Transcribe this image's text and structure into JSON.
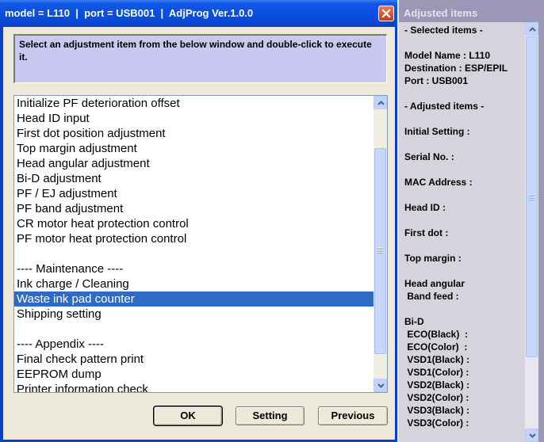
{
  "window": {
    "title": "model = L110  |  port = USB001  |  AdjProg Ver.1.0.0"
  },
  "instructions": "Select an adjustment item from the below window and double-click to execute it.",
  "list_items": [
    "Initialize PF deterioration offset",
    "Head ID input",
    "First dot position adjustment",
    "Top margin adjustment",
    "Head angular adjustment",
    "Bi-D adjustment",
    "PF / EJ adjustment",
    "PF band adjustment",
    "CR motor heat protection control",
    "PF motor heat protection control",
    "",
    "---- Maintenance ----",
    "Ink charge / Cleaning",
    "Waste ink pad counter",
    "Shipping setting",
    "",
    "---- Appendix ----",
    "Final check pattern print",
    "EEPROM dump",
    "Printer information check"
  ],
  "selected_index": 13,
  "buttons": {
    "ok": "OK",
    "setting": "Setting",
    "previous": "Previous"
  },
  "side_panel": {
    "title": "Adjusted items",
    "lines": [
      "- Selected items -",
      "",
      "Model Name : L110",
      "Destination : ESP/EPIL",
      "Port : USB001",
      "",
      "- Adjusted items -",
      "",
      "Initial Setting :",
      "",
      "Serial No. :",
      "",
      "MAC Address :",
      "",
      "Head ID :",
      "",
      "First dot :",
      "",
      "Top margin :",
      "",
      "Head angular",
      " Band feed :",
      "",
      "Bi-D",
      " ECO(Black)  :",
      " ECO(Color)  :",
      " VSD1(Black) :",
      " VSD1(Color) :",
      " VSD2(Black) :",
      " VSD2(Color) :",
      " VSD3(Black) :",
      " VSD3(Color) :"
    ]
  },
  "icons": {
    "close": "close-icon",
    "scroll_up": "chevron-up-icon",
    "scroll_down": "chevron-down-icon"
  },
  "colors": {
    "title_bar": "#0a4fe0",
    "selection": "#316ac5",
    "info_bg": "#c8c8f0",
    "side_title_bg": "#9a98b6",
    "close_button": "#c8391a"
  }
}
